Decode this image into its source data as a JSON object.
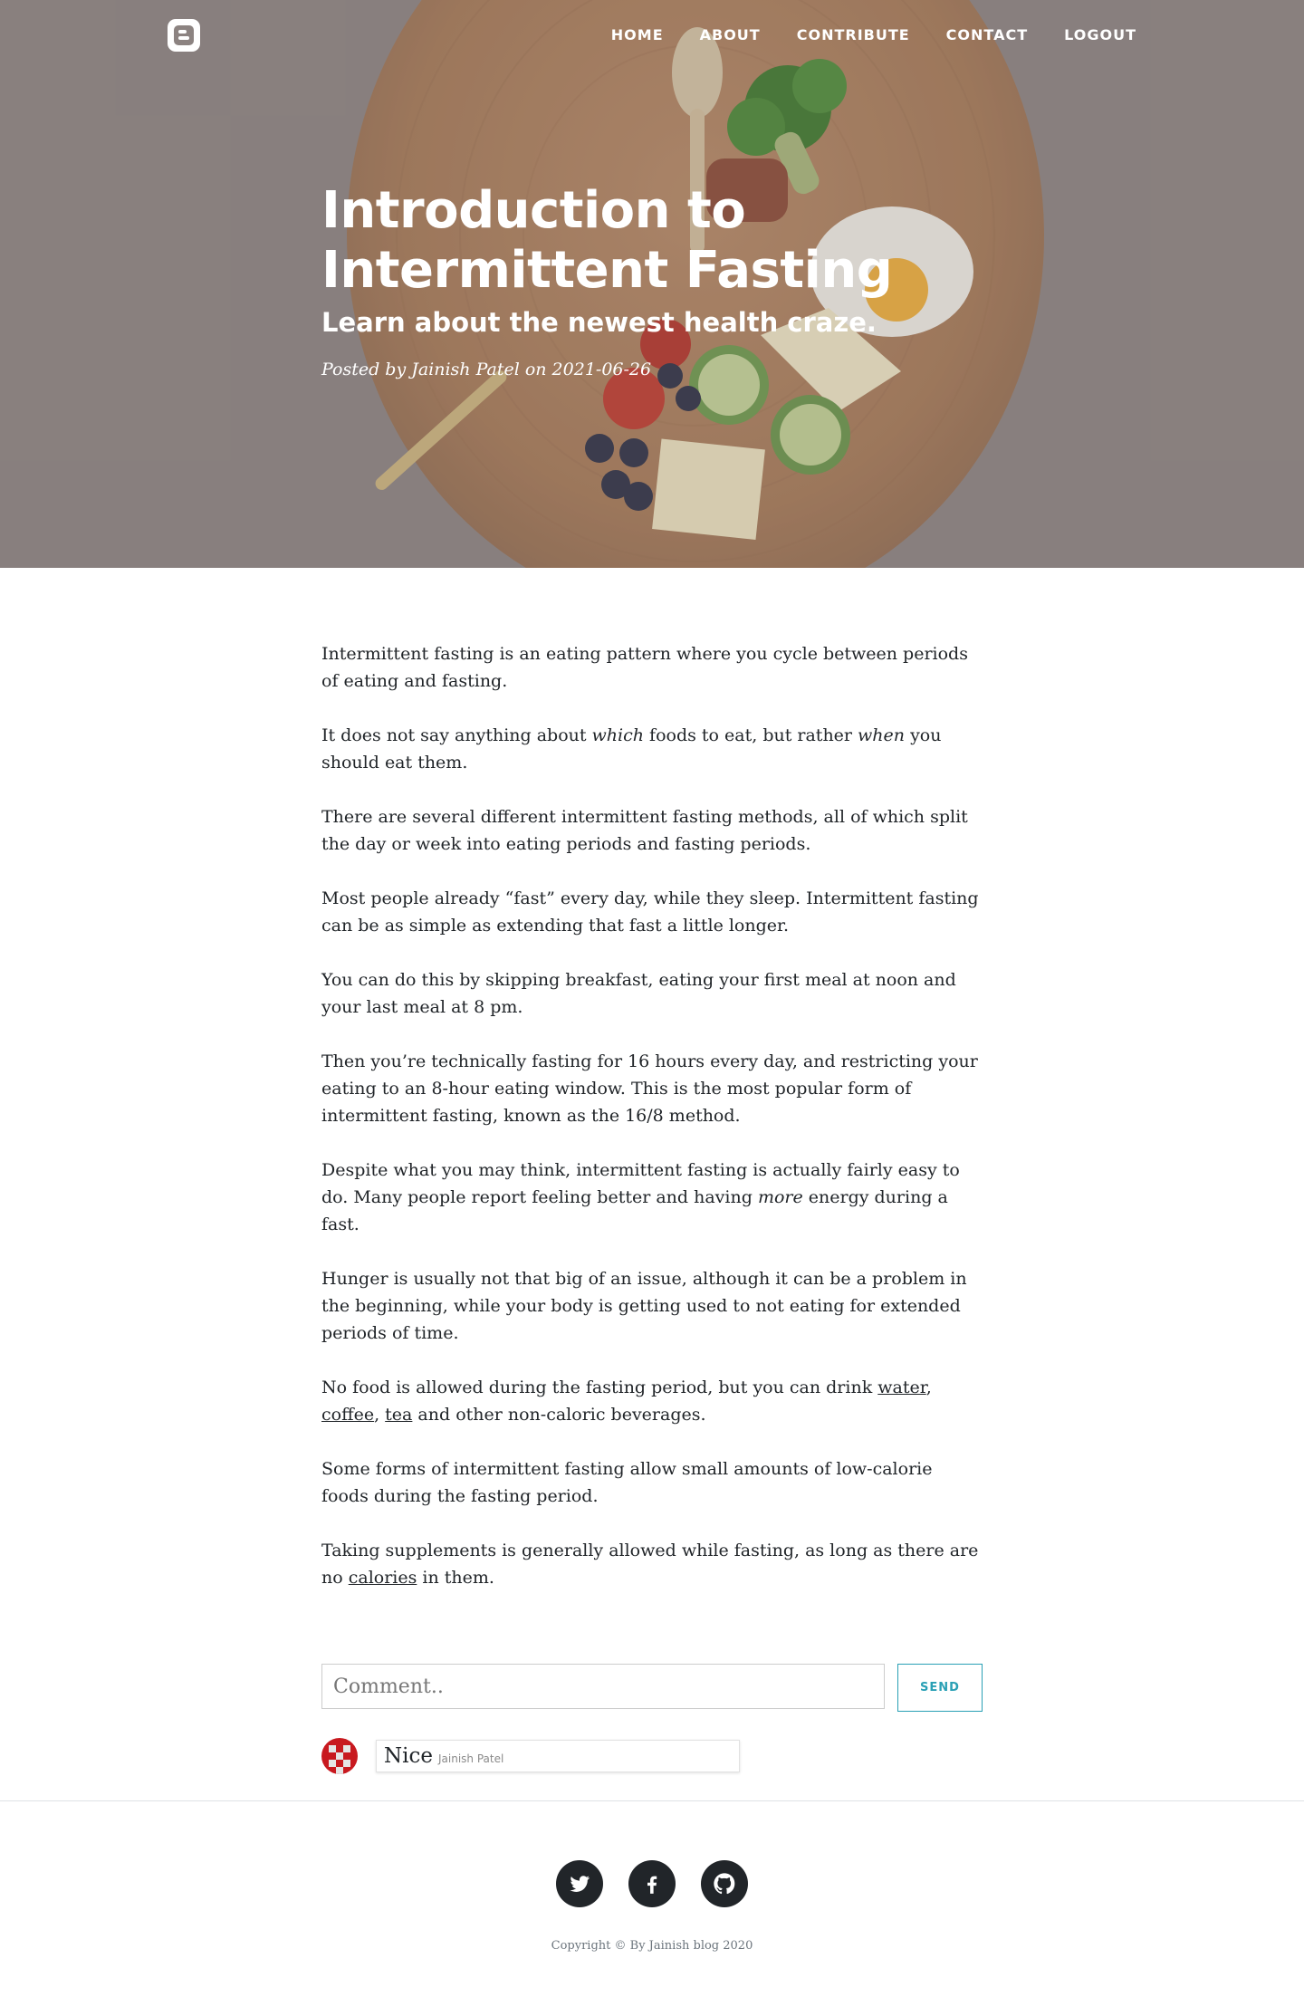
{
  "nav": {
    "items": [
      {
        "label": "HOME"
      },
      {
        "label": "ABOUT"
      },
      {
        "label": "CONTRIBUTE"
      },
      {
        "label": "CONTACT"
      },
      {
        "label": "LOGOUT"
      }
    ],
    "brand_icon": "blogger-icon"
  },
  "hero": {
    "title": "Introduction to Intermittent Fasting",
    "subtitle": "Learn about the newest health craze.",
    "meta": "Posted by Jainish Patel on 2021-06-26"
  },
  "article": {
    "p1": "Intermittent fasting is an eating pattern where you cycle between periods of eating and fasting.",
    "p2": {
      "a": "It does not say anything about ",
      "em1": "which",
      "b": " foods to eat, but rather ",
      "em2": "when",
      "c": " you should eat them."
    },
    "p3": "There are several different intermittent fasting methods, all of which split the day or week into eating periods and fasting periods.",
    "p4": "Most people already “fast” every day, while they sleep. Intermittent fasting can be as simple as extending that fast a little longer.",
    "p5": "You can do this by skipping breakfast, eating your first meal at noon and your last meal at 8 pm.",
    "p6": "Then you’re technically fasting for 16 hours every day, and restricting your eating to an 8-hour eating window. This is the most popular form of intermittent fasting, known as the 16/8 method.",
    "p7": {
      "a": "Despite what you may think, intermittent fasting is actually fairly easy to do. Many people report feeling better and having ",
      "em": "more",
      "b": " energy during a fast."
    },
    "p8": "Hunger is usually not that big of an issue, although it can be a problem in the beginning, while your body is getting used to not eating for extended periods of time.",
    "p9": {
      "a": "No food is allowed during the fasting period, but you can drink ",
      "link1": "water",
      "sep1": ", ",
      "link2": "coffee",
      "sep2": ", ",
      "link3": "tea",
      "b": " and other non-caloric beverages."
    },
    "p10": "Some forms of intermittent fasting allow small amounts of low-calorie foods during the fasting period.",
    "p11": {
      "a": "Taking supplements is generally allowed while fasting, as long as there are no ",
      "link": "calories",
      "b": " in them."
    }
  },
  "comment_form": {
    "placeholder": "Comment..",
    "send_label": "SEND"
  },
  "comments": [
    {
      "text": "Nice",
      "author": "Jainish Patel"
    }
  ],
  "footer": {
    "social": [
      "twitter-icon",
      "facebook-icon",
      "github-icon"
    ],
    "copyright": "Copyright © By Jainish blog 2020"
  },
  "colors": {
    "accent": "#2aa0b5",
    "dark": "#212529",
    "hero_bg": "#8c8381"
  }
}
